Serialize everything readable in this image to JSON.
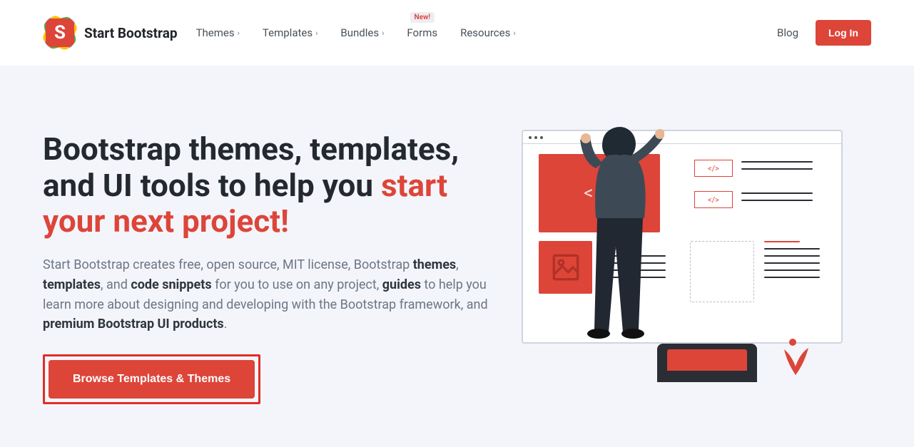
{
  "brand": {
    "name": "Start Bootstrap",
    "logo_letter": "S"
  },
  "nav": {
    "items": [
      {
        "label": "Themes",
        "has_chevron": true
      },
      {
        "label": "Templates",
        "has_chevron": true
      },
      {
        "label": "Bundles",
        "has_chevron": true
      },
      {
        "label": "Forms",
        "has_chevron": false,
        "badge": "New!"
      },
      {
        "label": "Resources",
        "has_chevron": true
      }
    ],
    "blog": "Blog",
    "login": "Log In"
  },
  "hero": {
    "title_plain": "Bootstrap themes, templates, and UI tools to help you ",
    "title_accent": "start your next project!",
    "desc_1": "Start Bootstrap creates free, open source, MIT license, Bootstrap ",
    "desc_b1": "themes",
    "desc_2": ", ",
    "desc_b2": "templates",
    "desc_3": ", and ",
    "desc_b3": "code snippets",
    "desc_4": " for you to use on any project, ",
    "desc_b4": "guides",
    "desc_5": " to help you learn more about designing and developing with the Bootstrap framework, and ",
    "desc_b5": "premium Bootstrap UI products",
    "desc_6": ".",
    "cta": "Browse Templates & Themes"
  },
  "illus": {
    "code_tag": "</>"
  }
}
